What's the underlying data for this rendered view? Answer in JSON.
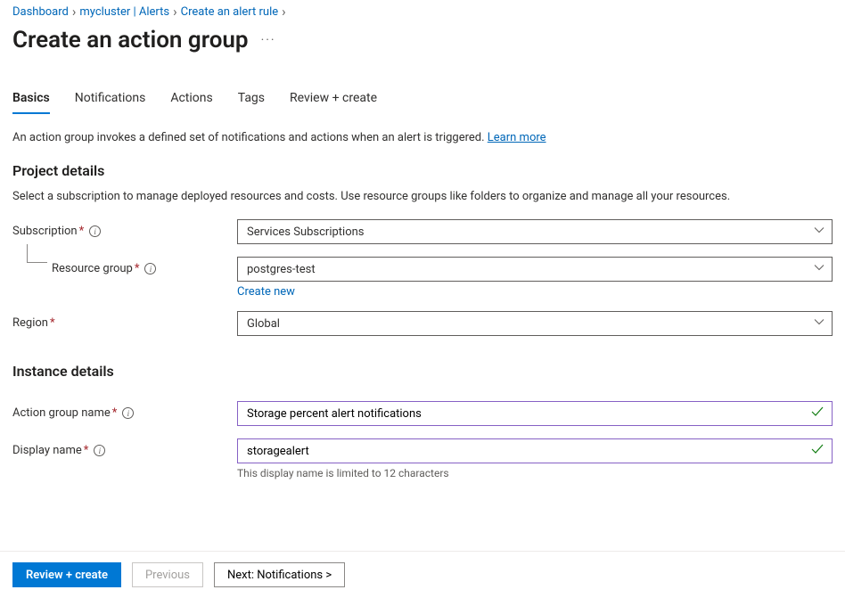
{
  "breadcrumb": {
    "items": [
      {
        "label": "Dashboard"
      },
      {
        "label": "mycluster | Alerts"
      },
      {
        "label": "Create an alert rule"
      }
    ]
  },
  "page": {
    "title": "Create an action group"
  },
  "tabs": {
    "items": [
      {
        "label": "Basics",
        "active": true
      },
      {
        "label": "Notifications"
      },
      {
        "label": "Actions"
      },
      {
        "label": "Tags"
      },
      {
        "label": "Review + create"
      }
    ]
  },
  "intro": {
    "text": "An action group invokes a defined set of notifications and actions when an alert is triggered. ",
    "learn_more": "Learn more"
  },
  "project": {
    "heading": "Project details",
    "description": "Select a subscription to manage deployed resources and costs. Use resource groups like folders to organize and manage all your resources.",
    "subscription_label": "Subscription",
    "subscription_value": "Services Subscriptions",
    "resource_group_label": "Resource group",
    "resource_group_value": "postgres-test",
    "create_new": "Create new",
    "region_label": "Region",
    "region_value": "Global"
  },
  "instance": {
    "heading": "Instance details",
    "action_group_label": "Action group name",
    "action_group_value": "Storage percent alert notifications",
    "display_name_label": "Display name",
    "display_name_value": "storagealert",
    "display_name_helper": "This display name is limited to 12 characters"
  },
  "footer": {
    "review": "Review + create",
    "previous": "Previous",
    "next": "Next: Notifications >"
  }
}
